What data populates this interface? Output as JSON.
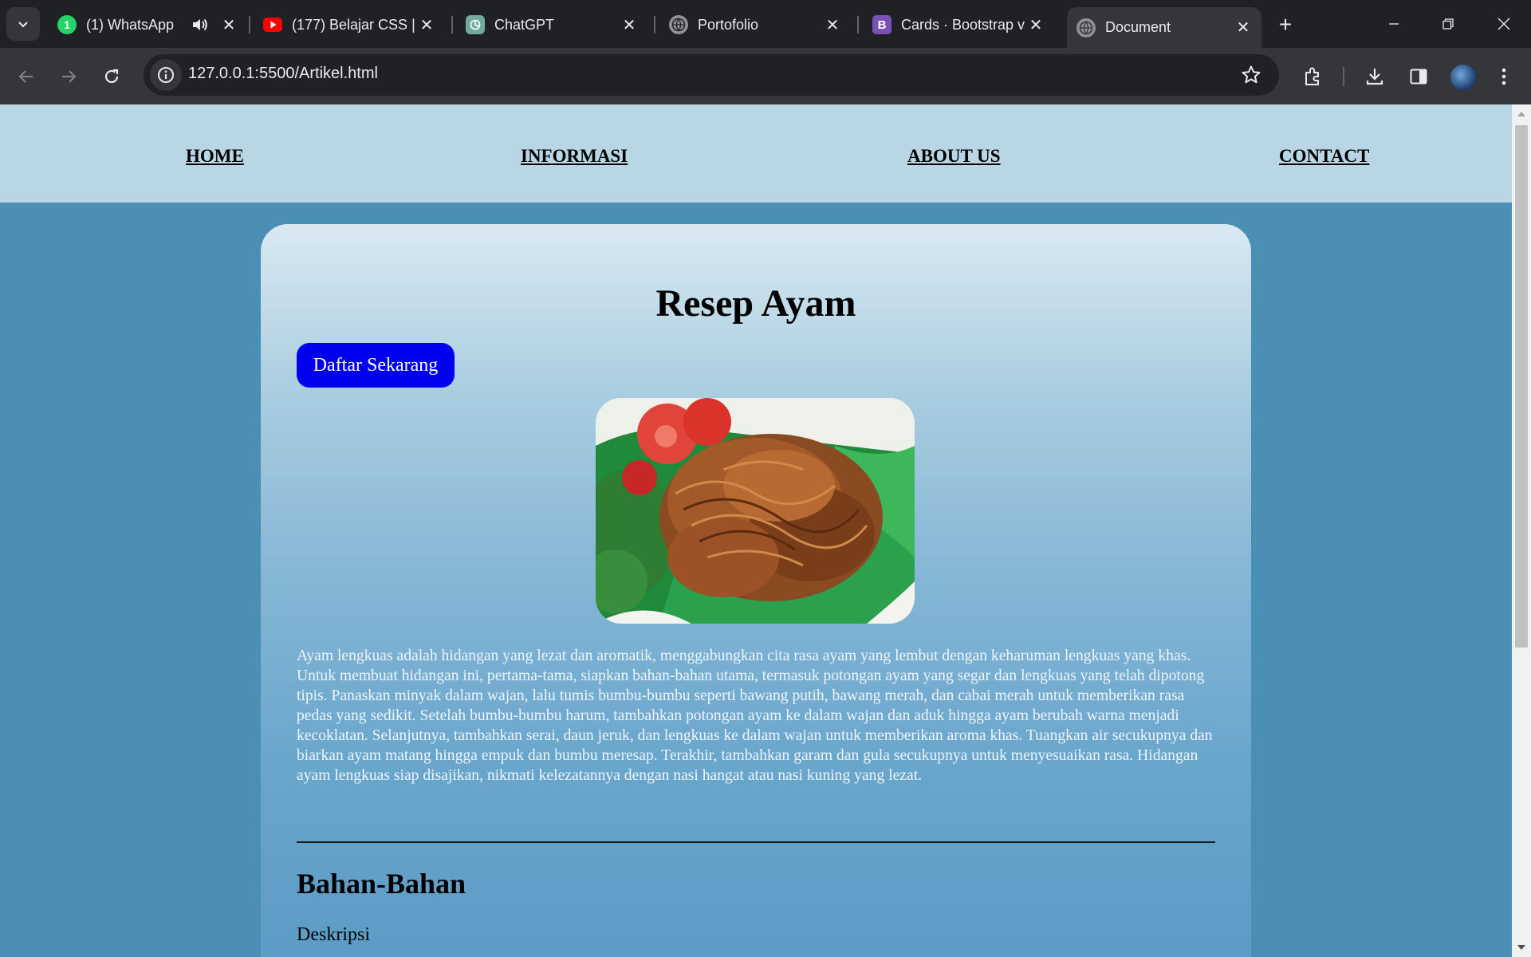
{
  "browser": {
    "tabs": [
      {
        "title": "(1) WhatsApp",
        "favicon": "whatsapp-icon",
        "badge": "1",
        "audio": true,
        "active": false
      },
      {
        "title": "(177) Belajar CSS |",
        "favicon": "youtube-icon",
        "active": false
      },
      {
        "title": "ChatGPT",
        "favicon": "chatgpt-icon",
        "active": false
      },
      {
        "title": "Portofolio",
        "favicon": "globe-icon",
        "active": false
      },
      {
        "title": "Cards · Bootstrap v",
        "favicon": "bootstrap-icon",
        "favicon_letter": "B",
        "active": false
      },
      {
        "title": "Document",
        "favicon": "globe-icon",
        "active": true
      }
    ],
    "url": "127.0.0.1:5500/Artikel.html",
    "colors": {
      "chrome_dark": "#202124",
      "chrome_toolbar": "#35363a",
      "text": "#e8eaed"
    }
  },
  "site": {
    "nav": [
      "HOME",
      "INFORMASI",
      "ABOUT US",
      "CONTACT"
    ],
    "title": "Resep Ayam",
    "cta": "Daftar Sekarang",
    "image": {
      "subject": "ayam-lengkuas-photo"
    },
    "paragraphs": [
      "Ayam lengkuas adalah hidangan yang lezat dan aromatik, menggabungkan cita rasa ayam yang lembut dengan keharuman lengkuas yang khas.",
      "Untuk membuat hidangan ini, pertama-tama, siapkan bahan-bahan utama, termasuk potongan ayam yang segar dan lengkuas yang telah dipotong tipis. Panaskan minyak dalam wajan, lalu tumis bumbu-bumbu seperti bawang putih, bawang merah, dan cabai merah untuk memberikan rasa pedas yang sedikit. Setelah bumbu-bumbu harum, tambahkan potongan ayam ke dalam wajan dan aduk hingga ayam berubah warna menjadi kecoklatan. Selanjutnya, tambahkan serai, daun jeruk, dan lengkuas ke dalam wajan untuk memberikan aroma khas. Tuangkan air secukupnya dan biarkan ayam matang hingga empuk dan bumbu meresap. Terakhir, tambahkan garam dan gula secukupnya untuk menyesuaikan rasa. Hidangan ayam lengkuas siap disajikan, nikmati kelezatannya dengan nasi hangat atau nasi kuning yang lezat."
    ],
    "section_heading": "Bahan-Bahan",
    "section_text": "Deskripsi",
    "colors": {
      "page_bg": "#4b90b4",
      "nav_bg": "#b8d6e3",
      "cta_bg": "#0000ee",
      "card_top": "#d9e9f1",
      "card_bottom": "#5a9ac4"
    }
  }
}
